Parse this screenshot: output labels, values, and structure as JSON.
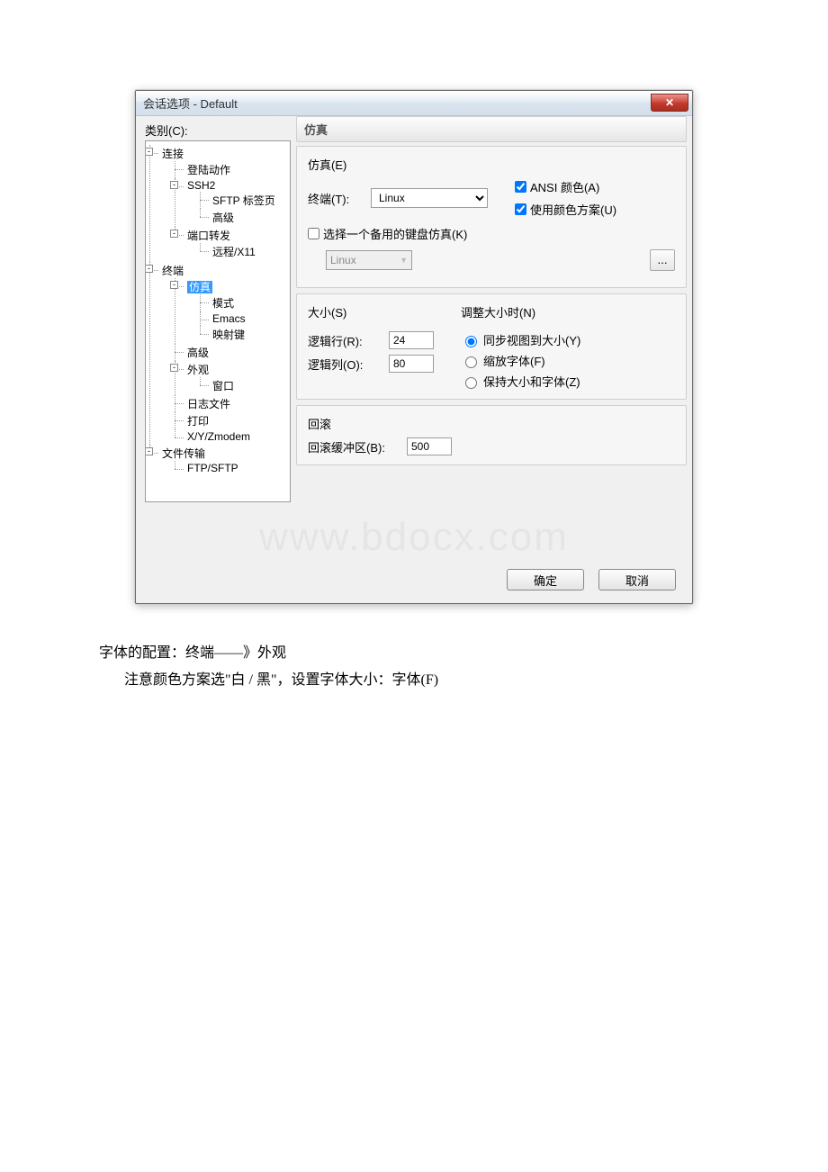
{
  "window": {
    "title": "会话选项 - Default"
  },
  "leftLabel": "类别(C):",
  "tree": {
    "connection": "连接",
    "login": "登陆动作",
    "ssh2": "SSH2",
    "sftpTab": "SFTP 标签页",
    "advanced1": "高级",
    "portFwd": "端口转发",
    "remoteX11": "远程/X11",
    "terminal": "终端",
    "emulation": "仿真",
    "mode": "模式",
    "emacs": "Emacs",
    "mapKeys": "映射键",
    "advanced2": "高级",
    "appearance": "外观",
    "window": "窗口",
    "logFile": "日志文件",
    "print": "打印",
    "xyzmodem": "X/Y/Zmodem",
    "fileTransfer": "文件传输",
    "ftpSftp": "FTP/SFTP"
  },
  "headers": {
    "emulation": "仿真",
    "emulationE": "仿真(E)"
  },
  "emu": {
    "terminalLabel": "终端(T):",
    "terminalValue": "Linux",
    "ansiColor": "ANSI 颜色(A)",
    "useScheme": "使用颜色方案(U)",
    "altKeyboardLabel": "选择一个备用的键盘仿真(K)",
    "altKeyboardValue": "Linux",
    "ellipsis": "..."
  },
  "size": {
    "title": "大小(S)",
    "logicalRowsLabel": "逻辑行(R):",
    "logicalRowsValue": "24",
    "logicalColsLabel": "逻辑列(O):",
    "logicalColsValue": "80"
  },
  "resize": {
    "title": "调整大小时(N)",
    "syncView": "同步视图到大小(Y)",
    "scaleFont": "缩放字体(F)",
    "keepSizeFont": "保持大小和字体(Z)"
  },
  "scroll": {
    "title": "回滚",
    "bufferLabel": "回滚缓冲区(B):",
    "bufferValue": "500"
  },
  "watermark": "www.bdocx.com",
  "buttons": {
    "ok": "确定",
    "cancel": "取消"
  },
  "caption": {
    "line1": "字体的配置：终端——》外观",
    "line2": "注意颜色方案选\"白 / 黑\"，设置字体大小：字体(F)"
  }
}
